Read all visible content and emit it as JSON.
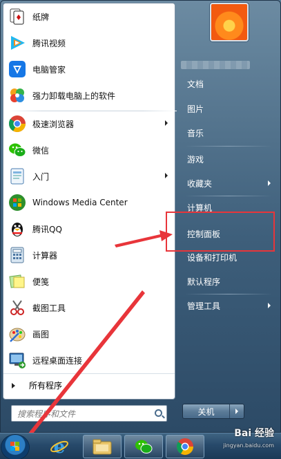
{
  "programs": [
    {
      "label": "纸牌",
      "icon": "solitaire-cards-icon"
    },
    {
      "label": "腾讯视频",
      "icon": "tencent-video-icon"
    },
    {
      "label": "电脑管家",
      "icon": "pc-manager-shield-icon"
    },
    {
      "label": "强力卸载电脑上的软件",
      "icon": "uninstaller-flower-icon"
    },
    {
      "label": "极速浏览器",
      "icon": "chrome-like-browser-icon",
      "submenu": true
    },
    {
      "label": "微信",
      "icon": "wechat-icon"
    },
    {
      "label": "入门",
      "icon": "getting-started-icon",
      "submenu": true
    },
    {
      "label": "Windows Media Center",
      "icon": "windows-media-center-icon"
    },
    {
      "label": "腾讯QQ",
      "icon": "qq-penguin-icon"
    },
    {
      "label": "计算器",
      "icon": "calculator-icon"
    },
    {
      "label": "便笺",
      "icon": "sticky-notes-icon"
    },
    {
      "label": "截图工具",
      "icon": "snipping-tool-icon"
    },
    {
      "label": "画图",
      "icon": "paint-palette-icon"
    },
    {
      "label": "远程桌面连接",
      "icon": "remote-desktop-icon"
    }
  ],
  "all_programs": "所有程序",
  "search": {
    "placeholder": "搜索程序和文件"
  },
  "right_items": [
    {
      "label": "文档"
    },
    {
      "label": "图片"
    },
    {
      "label": "音乐"
    },
    {
      "label": "游戏"
    },
    {
      "label": "收藏夹",
      "submenu": true
    },
    {
      "label": "计算机"
    },
    {
      "label": "控制面板"
    },
    {
      "label": "设备和打印机"
    },
    {
      "label": "默认程序"
    },
    {
      "label": "管理工具",
      "submenu": true
    }
  ],
  "shutdown": {
    "label": "关机"
  },
  "taskbar": {
    "pinned": [
      "internet-explorer-icon",
      "file-explorer-icon",
      "wechat-icon",
      "chrome-like-browser-icon"
    ]
  },
  "watermark": {
    "logo": "Bai 经验",
    "url": "jingyan.baidu.com"
  },
  "colors": {
    "annotation_red": "#e8353a",
    "menu_blue": "#3e5f7b"
  }
}
